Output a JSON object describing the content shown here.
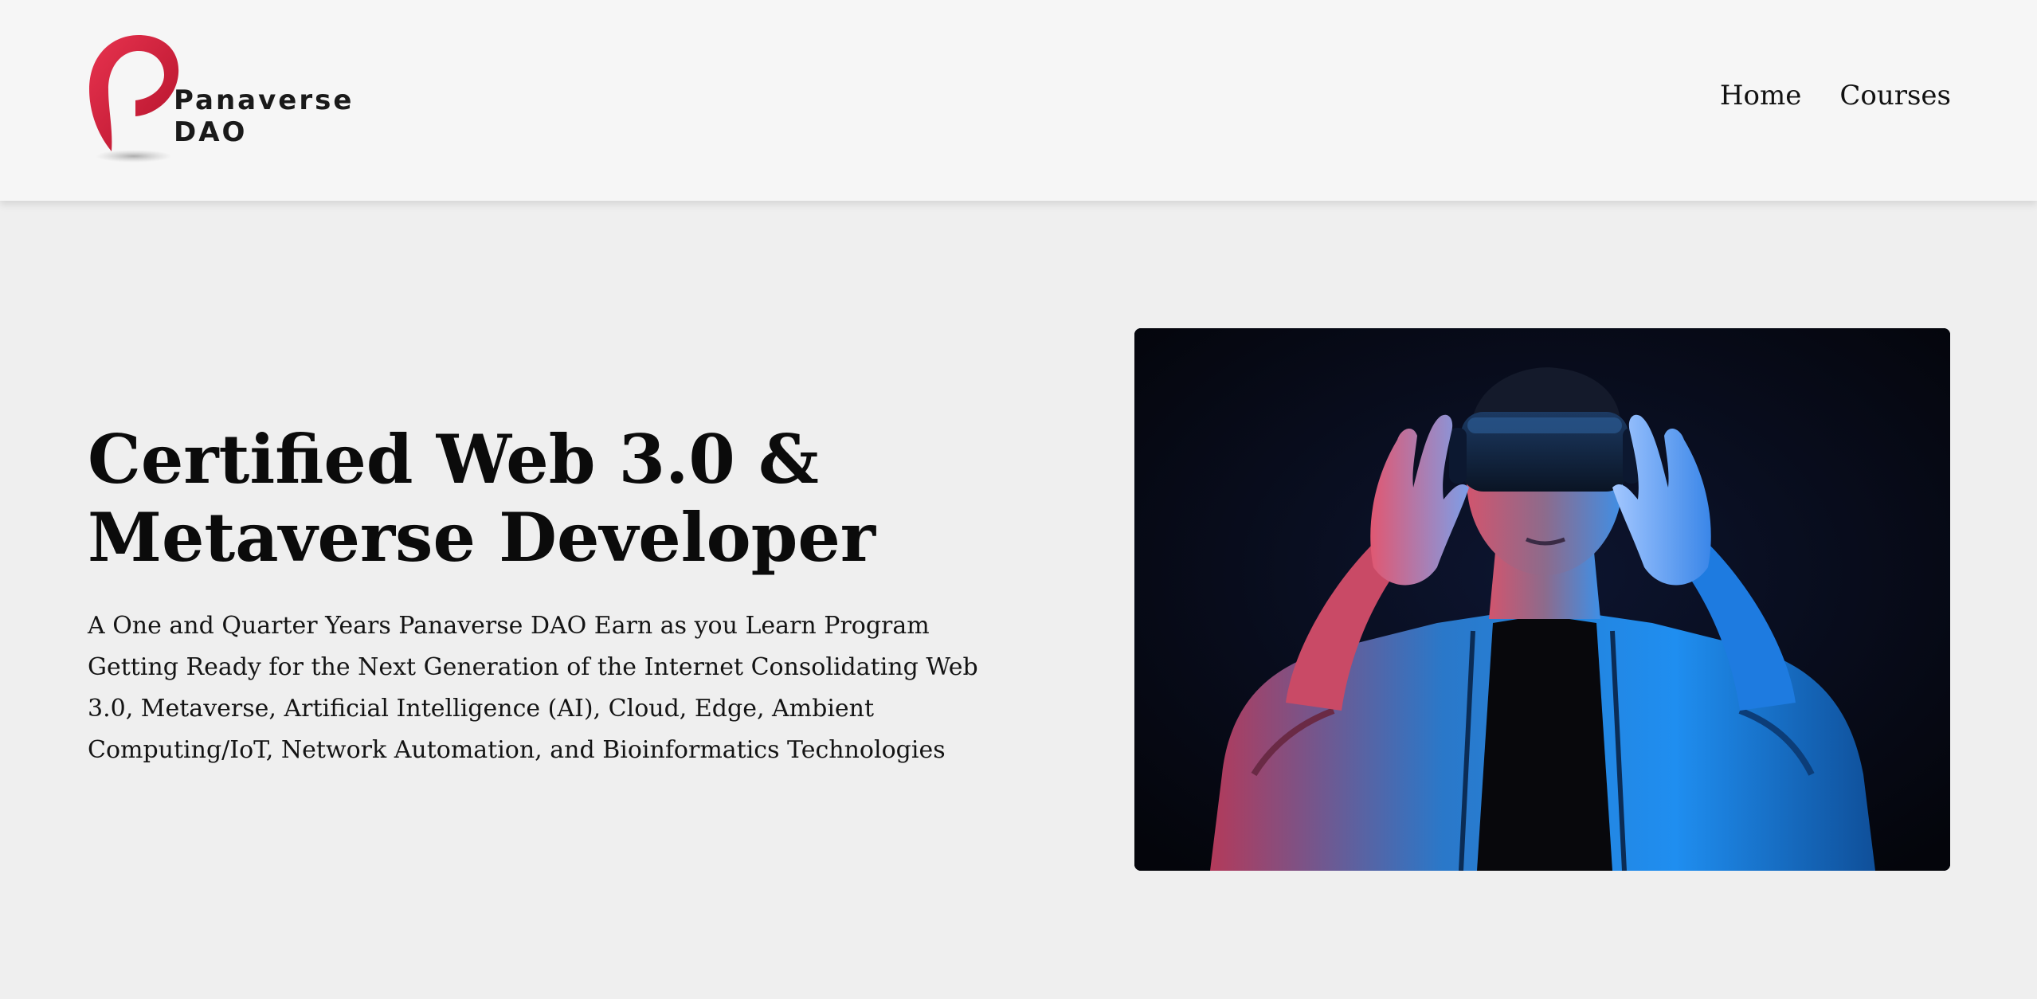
{
  "header": {
    "logo": {
      "line1": "Panaverse",
      "line2": "DAO",
      "accent_color": "#d81f3c"
    },
    "nav": [
      {
        "label": "Home"
      },
      {
        "label": "Courses"
      }
    ]
  },
  "hero": {
    "title_line1": "Certified Web 3.0 &",
    "title_line2": "Metaverse Developer",
    "subtitle": "A One and Quarter Years Panaverse DAO Earn as you Learn Program Getting Ready for the Next Generation of the Internet Consolidating Web 3.0, Metaverse, Artificial Intelligence (AI), Cloud, Edge, Ambient Computing/IoT, Network Automation, and Bioinformatics Technologies",
    "image_icon": "vr-headset-person-photo",
    "colors": {
      "background": "#efefef",
      "photo_background": "#05060d",
      "photo_blue": "#1a8cff",
      "photo_red": "#ff3b5c"
    }
  }
}
